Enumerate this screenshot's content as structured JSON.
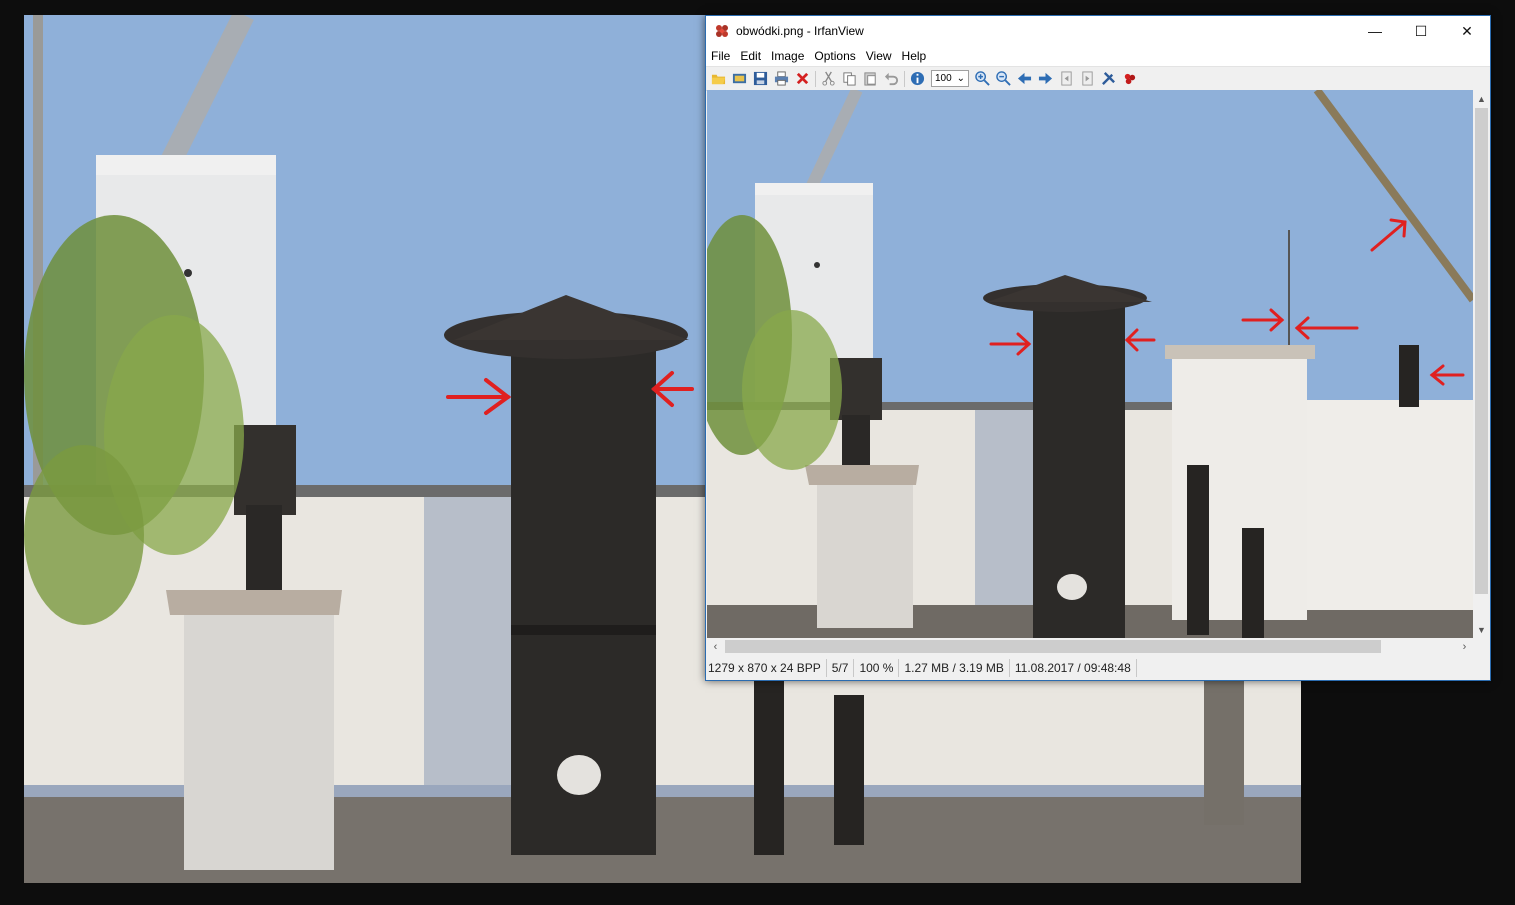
{
  "window": {
    "title": "obwódki.png - IrfanView",
    "controls": {
      "minimize": "—",
      "maximize": "☐",
      "close": "✕"
    }
  },
  "menu": [
    "File",
    "Edit",
    "Image",
    "Options",
    "View",
    "Help"
  ],
  "toolbar": {
    "buttons": [
      "open-icon",
      "thumbnails-icon",
      "save-icon",
      "print-icon",
      "delete-icon",
      "cut-icon",
      "copy-icon",
      "paste-icon",
      "undo-icon",
      "info-icon",
      "zoom-in-icon",
      "zoom-out-icon",
      "previous-icon",
      "next-icon",
      "first-page-icon",
      "last-page-icon",
      "settings-icon",
      "irfanview-icon"
    ],
    "zoom_value": "100"
  },
  "statusbar": {
    "dimensions": "1279 x 870 x 24 BPP",
    "index": "5/7",
    "zoom": "100 %",
    "size": "1.27 MB / 3.19 MB",
    "datetime": "11.08.2017 / 09:48:48"
  },
  "colors": {
    "sky": "#8fb0d9",
    "annotation": "#e02020",
    "window_border": "#2b6cb0"
  }
}
